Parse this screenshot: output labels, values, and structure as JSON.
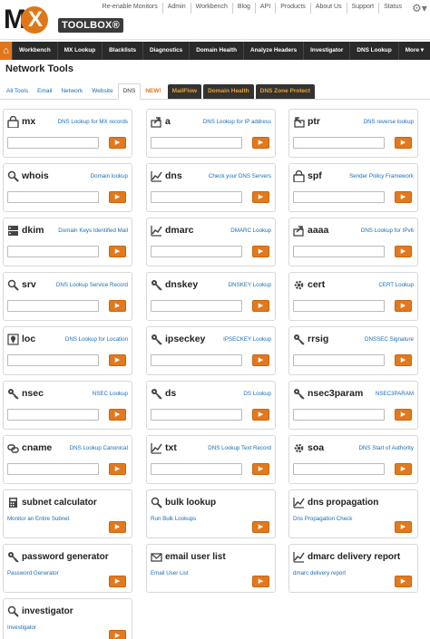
{
  "header": {
    "logo_mx": "M",
    "logo_x": "X",
    "logo_toolbox": "TOOLBOX®",
    "links": [
      "Re-enable Monitors",
      "Admin",
      "Workbench",
      "Blog",
      "API",
      "Products",
      "About Us",
      "Support",
      "Status"
    ]
  },
  "nav": {
    "items": [
      "Workbench",
      "MX Lookup",
      "Blacklists",
      "Diagnostics",
      "Domain Health",
      "Analyze Headers",
      "Investigator",
      "DNS Lookup"
    ],
    "more": "More ▾"
  },
  "page_title": "Network Tools",
  "tabs": {
    "plain": [
      "All Tools",
      "Email",
      "Network",
      "Website"
    ],
    "active": "DNS",
    "new_label": "NEW!",
    "dark": [
      "MailFlow",
      "Domain Health",
      "DNS Zone Protect"
    ]
  },
  "go_glyph": "▶",
  "tools": [
    {
      "name": "mx",
      "desc": "DNS Lookup for MX records",
      "icon": "lock-icon"
    },
    {
      "name": "a",
      "desc": "DNS Lookup for IP address",
      "icon": "share-arrow-icon"
    },
    {
      "name": "ptr",
      "desc": "DNS reverse lookup",
      "icon": "reverse-arrow-icon"
    },
    {
      "name": "whois",
      "desc": "Domain lookup",
      "icon": "magnifier-icon"
    },
    {
      "name": "dns",
      "desc": "Check your DNS Servers",
      "icon": "chart-icon"
    },
    {
      "name": "spf",
      "desc": "Sender Policy Framework",
      "icon": "lock-icon"
    },
    {
      "name": "dkim",
      "desc": "Domain Keys Identified Mail",
      "icon": "server-icon"
    },
    {
      "name": "dmarc",
      "desc": "DMARC Lookup",
      "icon": "chart-icon"
    },
    {
      "name": "aaaa",
      "desc": "DNS Lookup for IPv6",
      "icon": "share-arrow-icon"
    },
    {
      "name": "srv",
      "desc": "DNS Lookup Service Record",
      "icon": "magnifier-icon"
    },
    {
      "name": "dnskey",
      "desc": "DNSKEY Lookup",
      "icon": "key-icon"
    },
    {
      "name": "cert",
      "desc": "CERT Lookup",
      "icon": "gear-icon"
    },
    {
      "name": "loc",
      "desc": "DNS Lookup for Location",
      "icon": "pin-icon"
    },
    {
      "name": "ipseckey",
      "desc": "IPSECKEY Lookup",
      "icon": "key-icon"
    },
    {
      "name": "rrsig",
      "desc": "DNSSEC Signature",
      "icon": "key-icon"
    },
    {
      "name": "nsec",
      "desc": "NSEC Lookup",
      "icon": "key-icon"
    },
    {
      "name": "ds",
      "desc": "DS Lookup",
      "icon": "key-icon"
    },
    {
      "name": "nsec3param",
      "desc": "NSEC3PARAM",
      "icon": "key-icon"
    },
    {
      "name": "cname",
      "desc": "DNS Lookup Canonical",
      "icon": "link-icon"
    },
    {
      "name": "txt",
      "desc": "DNS Lookup Text Record",
      "icon": "chart-icon"
    },
    {
      "name": "soa",
      "desc": "DNS Start of Authority",
      "icon": "gear-icon"
    }
  ],
  "wide_tools": [
    {
      "name": "subnet calculator",
      "desc": "Monitor an Entire Subnet",
      "icon": "calculator-icon"
    },
    {
      "name": "bulk lookup",
      "desc": "Run Bulk Lookups",
      "icon": "magnifier-icon"
    },
    {
      "name": "dns propagation",
      "desc": "Dns Propagation Check",
      "icon": "chart-icon"
    },
    {
      "name": "password generator",
      "desc": "Password Generator",
      "icon": "key-icon"
    },
    {
      "name": "email user list",
      "desc": "Email User List",
      "icon": "envelope-icon"
    },
    {
      "name": "dmarc delivery report",
      "desc": "dmarc delivery report",
      "icon": "chart-icon"
    },
    {
      "name": "investigator",
      "desc": "Investigator",
      "icon": "magnifier-icon"
    }
  ]
}
